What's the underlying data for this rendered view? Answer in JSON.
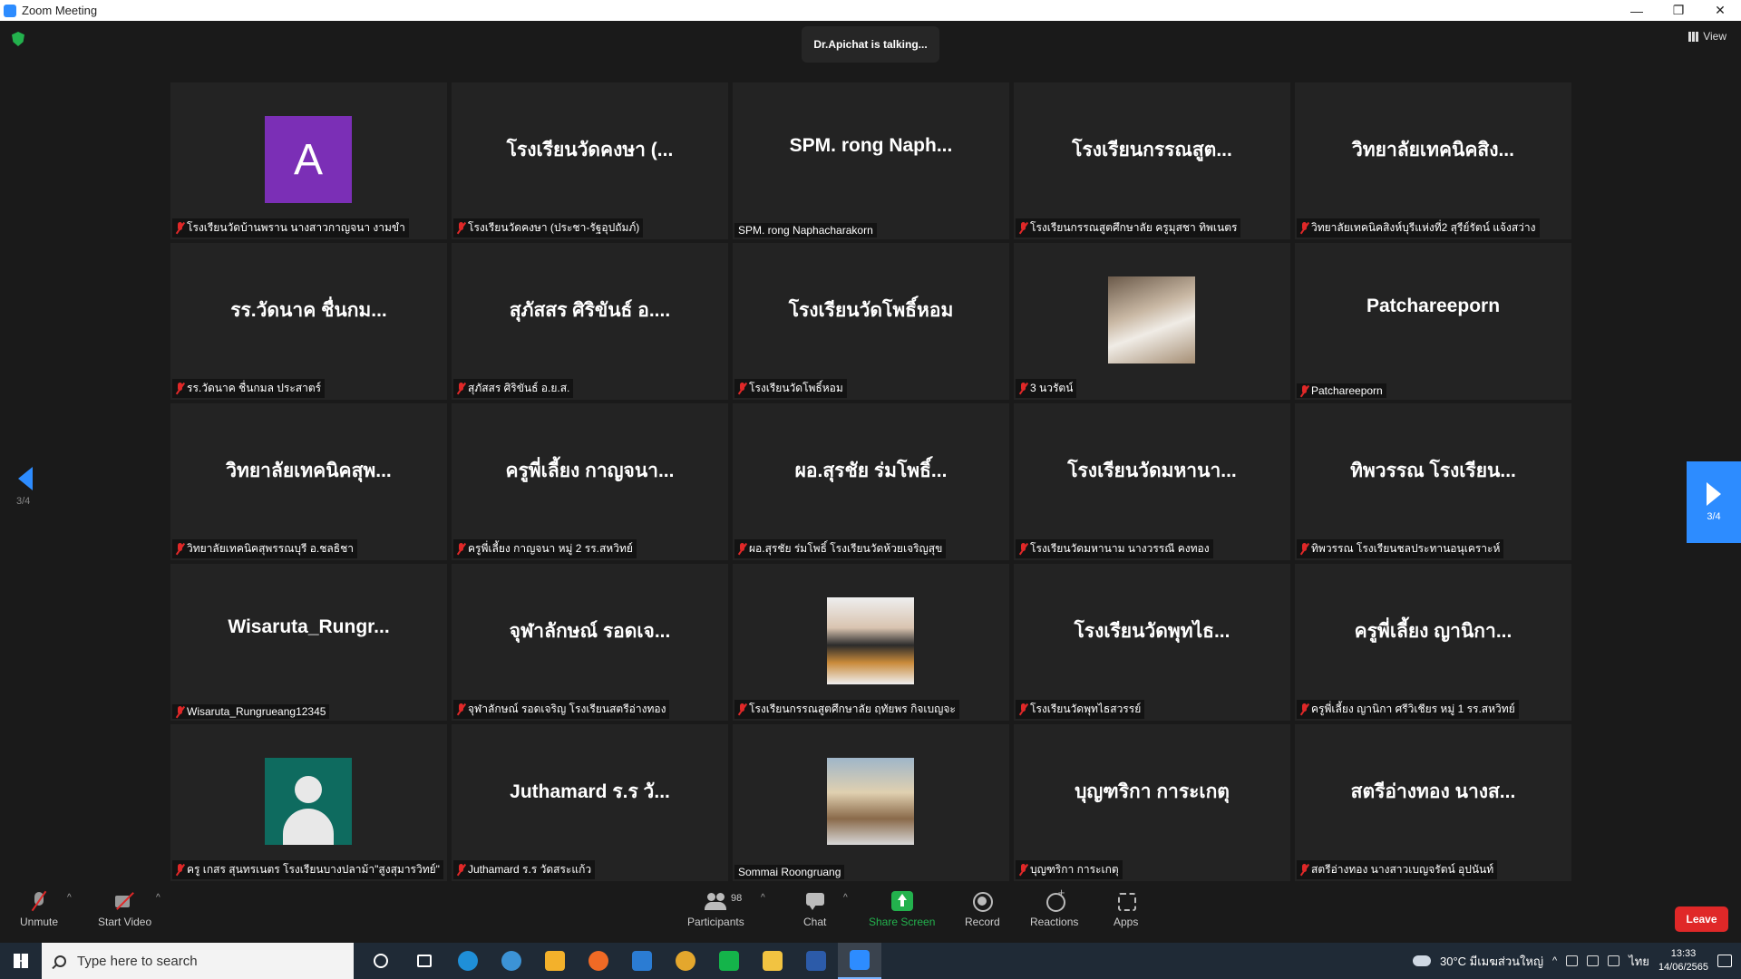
{
  "window": {
    "title": "Zoom Meeting",
    "controls": [
      "—",
      "❐",
      "✕"
    ]
  },
  "meeting": {
    "talking_indicator": "Dr.Apichat is talking...",
    "view_label": "View",
    "page_indicator": "3/4"
  },
  "tiles": [
    {
      "big": "",
      "avatar": "letter",
      "letter": "A",
      "name": "โรงเรียนวัดบ้านพราน นางสาวกาญจนา งามขำ",
      "muted": true
    },
    {
      "big": "โรงเรียนวัดคงษา (...",
      "name": "โรงเรียนวัดคงษา (ประชา-รัฐอุปถัมภ์)",
      "muted": true
    },
    {
      "big": "SPM. rong Naph...",
      "name": "SPM. rong Naphacharakorn",
      "muted": false
    },
    {
      "big": "โรงเรียนกรรณสูต...",
      "name": "โรงเรียนกรรณสูตศึกษาลัย ครูมุสชา ทิพเนตร",
      "muted": true
    },
    {
      "big": "วิทยาลัยเทคนิคสิง...",
      "name": "วิทยาลัยเทคนิคสิงห์บุรีแห่งที่2 สุรีย์รัตน์ แจ้งสว่าง",
      "muted": true
    },
    {
      "big": "รร.วัดนาค ชื่นกม...",
      "name": "รร.วัดนาค ชื่นกมล ประสาตร์",
      "muted": true
    },
    {
      "big": "สุภัสสร ศิริขันธ์ อ....",
      "name": "สุภัสสร ศิริขันธ์ อ.ย.ส.",
      "muted": true
    },
    {
      "big": "โรงเรียนวัดโพธิ์หอม",
      "name": "โรงเรียนวัดโพธิ์หอม",
      "muted": true
    },
    {
      "big": "",
      "avatar": "photo1",
      "name": "3 นวรัตน์",
      "muted": true
    },
    {
      "big": "Patchareeporn",
      "name": "Patchareeporn",
      "muted": true
    },
    {
      "big": "วิทยาลัยเทคนิคสุพ...",
      "name": "วิทยาลัยเทคนิคสุพรรณบุรี อ.ชลธิชา",
      "muted": true
    },
    {
      "big": "ครูพี่เลี้ยง กาญจนา...",
      "name": "ครูพี่เลี้ยง กาญจนา หมู่ 2 รร.สหวิทย์",
      "muted": true
    },
    {
      "big": "ผอ.สุรชัย ร่มโพธิ์...",
      "name": "ผอ.สุรชัย ร่มโพธิ์ โรงเรียนวัดห้วยเจริญสุข",
      "muted": true
    },
    {
      "big": "โรงเรียนวัดมหานา...",
      "name": "โรงเรียนวัดมหานาม นางวรรณี คงทอง",
      "muted": true
    },
    {
      "big": "ทิพวรรณ โรงเรียน...",
      "name": "ทิพวรรณ โรงเรียนชลประทานอนุเคราะห์",
      "muted": true
    },
    {
      "big": "Wisaruta_Rungr...",
      "name": "Wisaruta_Rungrueang12345",
      "muted": true
    },
    {
      "big": "จุฬาลักษณ์ รอดเจ...",
      "name": "จุฬาลักษณ์ รอดเจริญ โรงเรียนสตรีอ่างทอง",
      "muted": true
    },
    {
      "big": "",
      "avatar": "photo2",
      "name": "โรงเรียนกรรณสูตศึกษาลัย ฤทัยพร กิจเบญจะ",
      "muted": true
    },
    {
      "big": "โรงเรียนวัดพุทไธ...",
      "name": "โรงเรียนวัดพุทไธสวรรย์",
      "muted": true
    },
    {
      "big": "ครูพี่เลี้ยง ญานิกา...",
      "name": "ครูพี่เลี้ยง ญานิกา ศรีวิเชียร หมู่ 1 รร.สหวิทย์",
      "muted": true
    },
    {
      "big": "",
      "avatar": "person",
      "name": "ครู เกสร สุนทรเนตร โรงเรียนบางปลาม้า\"สูงสุมารวิทย์\"",
      "muted": true
    },
    {
      "big": "Juthamard ร.ร วั...",
      "name": "Juthamard ร.ร วัดสระแก้ว",
      "muted": true
    },
    {
      "big": "",
      "avatar": "photo3",
      "name": "Sommai Roongruang",
      "muted": false
    },
    {
      "big": "บุญฑริกา การะเกตุ",
      "name": "บุญฑริกา การะเกตุ",
      "muted": true
    },
    {
      "big": "สตรีอ่างทอง นางส...",
      "name": "สตรีอ่างทอง นางสาวเบญจรัตน์ อุปนันท์",
      "muted": true
    }
  ],
  "toolbar": {
    "unmute": "Unmute",
    "start_video": "Start Video",
    "participants": "Participants",
    "participants_count": "98",
    "chat": "Chat",
    "share_screen": "Share Screen",
    "record": "Record",
    "reactions": "Reactions",
    "apps": "Apps",
    "leave": "Leave"
  },
  "taskbar": {
    "search_placeholder": "Type here to search",
    "weather": "30°C มีเมฆส่วนใหญ่",
    "language": "ไทย",
    "time": "13:33",
    "date": "14/06/2565",
    "apps": [
      {
        "name": "cortana-icon",
        "color": "#2a3542"
      },
      {
        "name": "task-view-icon",
        "color": "#2a3542"
      },
      {
        "name": "edge-icon",
        "color": "#1f8fd8"
      },
      {
        "name": "internet-explorer-icon",
        "color": "#3c93d6"
      },
      {
        "name": "store-icon",
        "color": "#f3b12b"
      },
      {
        "name": "firefox-icon",
        "color": "#f06a25"
      },
      {
        "name": "mail-icon",
        "color": "#2b7cd3"
      },
      {
        "name": "chrome-icon",
        "color": "#e4a72d"
      },
      {
        "name": "line-icon",
        "color": "#14b44a"
      },
      {
        "name": "file-explorer-icon",
        "color": "#f2c341"
      },
      {
        "name": "word-icon",
        "color": "#2c5ba9"
      },
      {
        "name": "zoom-icon",
        "color": "#2d8cff"
      }
    ]
  },
  "colors": {
    "accent": "#2d8cff",
    "leave": "#e02828",
    "share": "#23b14d",
    "tile_bg": "#232323"
  }
}
